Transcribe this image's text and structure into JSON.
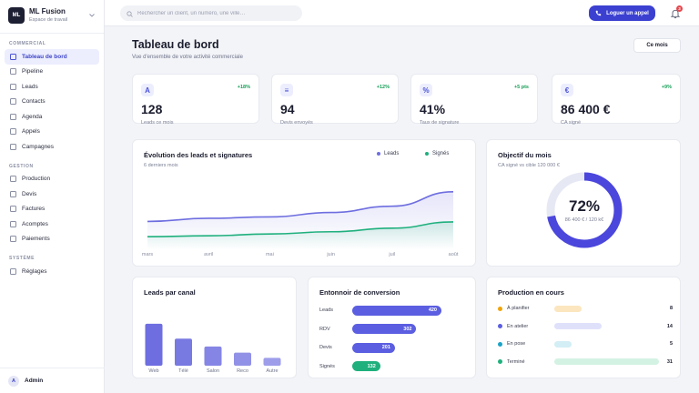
{
  "brand": {
    "logo": "ML",
    "name": "ML Fusion",
    "subtitle": "Espace de travail",
    "chevron_icon": "chevron-down-icon"
  },
  "sidebar": {
    "sections": [
      {
        "label": "COMMERCIAL",
        "items": [
          {
            "label": "Tableau de bord",
            "active": true
          },
          {
            "label": "Pipeline"
          },
          {
            "label": "Leads"
          },
          {
            "label": "Contacts"
          },
          {
            "label": "Agenda"
          },
          {
            "label": "Appels"
          },
          {
            "label": "Campagnes"
          }
        ]
      },
      {
        "label": "GESTION",
        "items": [
          {
            "label": "Production"
          },
          {
            "label": "Devis"
          },
          {
            "label": "Factures"
          },
          {
            "label": "Acomptes"
          },
          {
            "label": "Paiements"
          }
        ]
      },
      {
        "label": "SYSTÈME",
        "items": [
          {
            "label": "Réglages"
          }
        ]
      }
    ],
    "user": {
      "initial": "A",
      "name": "Admin"
    }
  },
  "topbar": {
    "search_placeholder": "Rechercher un client, un numéro, une ville…",
    "call_button": "Loguer un appel",
    "notification_count": "3"
  },
  "header": {
    "title": "Tableau de bord",
    "subtitle": "Vue d'ensemble de votre activité commerciale",
    "period_button": "Ce mois"
  },
  "kpis": [
    {
      "icon": "A",
      "delta": "+18%",
      "value": "128",
      "label": "Leads ce mois"
    },
    {
      "icon": "≡",
      "delta": "+12%",
      "value": "94",
      "label": "Devis envoyés"
    },
    {
      "icon": "%",
      "delta": "+5 pts",
      "value": "41%",
      "label": "Taux de signature"
    },
    {
      "icon": "€",
      "delta": "+9%",
      "value": "86 400 €",
      "label": "CA signé"
    }
  ],
  "trend": {
    "title": "Évolution des leads et signatures",
    "subtitle": "6 derniers mois",
    "chart_data": {
      "type": "area",
      "x": [
        "mars",
        "avril",
        "mai",
        "juin",
        "juil",
        "août"
      ],
      "series": [
        {
          "name": "Leads",
          "color": "#6e6ee0",
          "values": [
            62,
            69,
            72,
            82,
            96,
            128
          ]
        },
        {
          "name": "Signés",
          "color": "#1fb07d",
          "values": [
            28,
            30,
            34,
            39,
            47,
            61
          ]
        }
      ],
      "ylim": [
        0,
        150
      ],
      "grid": false,
      "legend": "top-right"
    }
  },
  "goal": {
    "title": "Objectif du mois",
    "subtitle": "CA signé vs cible 120 000 €",
    "percent_label": "72%",
    "detail": "86 400 € / 120 k€",
    "progress": 0.72,
    "color": "#4b46dc",
    "track_color": "#e6e8f4"
  },
  "channels": {
    "title": "Leads par canal",
    "chart_data": {
      "type": "bar",
      "categories": [
        "Web",
        "Télé",
        "Salon",
        "Reco",
        "Autre"
      ],
      "values": [
        48,
        31,
        22,
        15,
        9
      ],
      "ylim": [
        0,
        50
      ],
      "color": "#6e6ee0"
    }
  },
  "funnel": {
    "title": "Entonnoir de conversion",
    "chart_data": {
      "type": "bar",
      "categories": [
        "Leads",
        "RDV",
        "Devis",
        "Signés"
      ],
      "values": [
        420,
        302,
        201,
        132
      ],
      "xlim": [
        0,
        420
      ],
      "colors": [
        "#5b5ee0",
        "#5b5ee0",
        "#5b5ee0",
        "#1fb07d"
      ]
    }
  },
  "production": {
    "title": "Production en cours",
    "items": [
      {
        "label": "À planifier",
        "value": "8",
        "count": 8,
        "dot": "#f0a30a",
        "bar": "#fbe6bf"
      },
      {
        "label": "En atelier",
        "value": "14",
        "count": 14,
        "dot": "#5b5ee0",
        "bar": "#dfe1fb"
      },
      {
        "label": "En pose",
        "value": "5",
        "count": 5,
        "dot": "#1ba3c6",
        "bar": "#d3eef5"
      },
      {
        "label": "Terminé",
        "value": "31",
        "count": 31,
        "dot": "#1fb07d",
        "bar": "#d4f2e4"
      }
    ]
  }
}
